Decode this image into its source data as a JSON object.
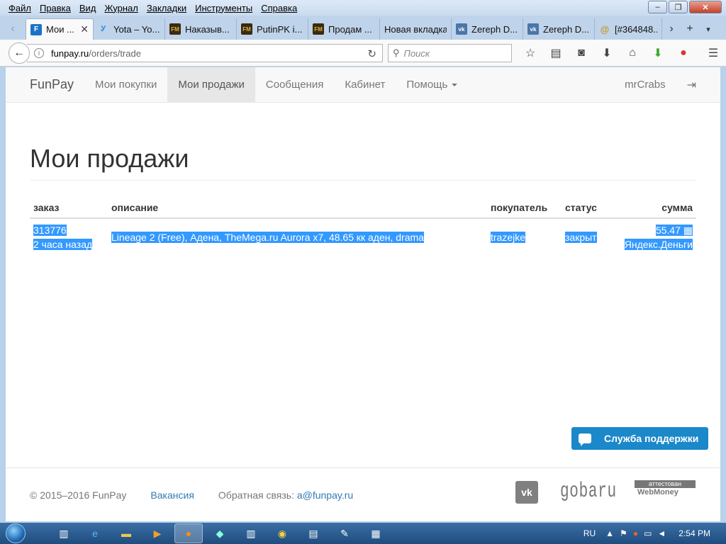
{
  "menubar": {
    "items": [
      "Файл",
      "Правка",
      "Вид",
      "Журнал",
      "Закладки",
      "Инструменты",
      "Справка"
    ],
    "minimize": "‒",
    "maximize": "❐",
    "close": "✕"
  },
  "tabs": [
    {
      "label": "Мои ...",
      "favicon_text": "F",
      "favicon_color": "#1a73c8"
    },
    {
      "label": "Yota – Yo...",
      "favicon_text": "Ꭹ",
      "favicon_color": "#2a8ee0"
    },
    {
      "label": "Наказыв...",
      "favicon_text": "FM",
      "favicon_color": "#3a2a10"
    },
    {
      "label": "PutinPK i...",
      "favicon_text": "FM",
      "favicon_color": "#3a2a10"
    },
    {
      "label": "Продам ...",
      "favicon_text": "FM",
      "favicon_color": "#3a2a10"
    },
    {
      "label": "Новая вкладка",
      "favicon_text": "",
      "favicon_color": "transparent"
    },
    {
      "label": "Zereph D...",
      "favicon_text": "vk",
      "favicon_color": "#4a76a8"
    },
    {
      "label": "Zereph D...",
      "favicon_text": "vk",
      "favicon_color": "#4a76a8"
    },
    {
      "label": "[#364848...",
      "favicon_text": "@",
      "favicon_color": "#c09a20"
    }
  ],
  "tab_close": "✕",
  "url": {
    "host": "funpay.ru",
    "path": "/orders/trade"
  },
  "search": {
    "placeholder": "Поиск"
  },
  "site": {
    "brand": "FunPay",
    "nav": [
      "Мои покупки",
      "Мои продажи",
      "Сообщения",
      "Кабинет",
      "Помощь"
    ],
    "user": "mrCrabs"
  },
  "page_title": "Мои продажи",
  "table": {
    "headers": {
      "order": "заказ",
      "description": "описание",
      "buyer": "покупатель",
      "status": "статус",
      "amount": "сумма"
    },
    "rows": [
      {
        "order_id": "313776",
        "time": "2 часа назад",
        "description": "Lineage 2 (Free), Адена, TheMega.ru Aurora x7, 48.65 кк аден, drama",
        "buyer": "trazejke",
        "status": "закрыт",
        "amount": "55.47",
        "payment": "Яндекс.Деньги"
      }
    ]
  },
  "footer": {
    "copyright": "© 2015–2016 FunPay",
    "vacancy": "Вакансия",
    "feedback_label": "Обратная связь:",
    "feedback_email": "a@funpay.ru",
    "vk": "vk",
    "gobaru": "gobaru",
    "wm_top": "аттестован",
    "wm_bottom": "WebMoney"
  },
  "support": {
    "label": "Служба поддержки"
  },
  "taskbar": {
    "lang": "RU",
    "clock": "2:54 PM"
  }
}
